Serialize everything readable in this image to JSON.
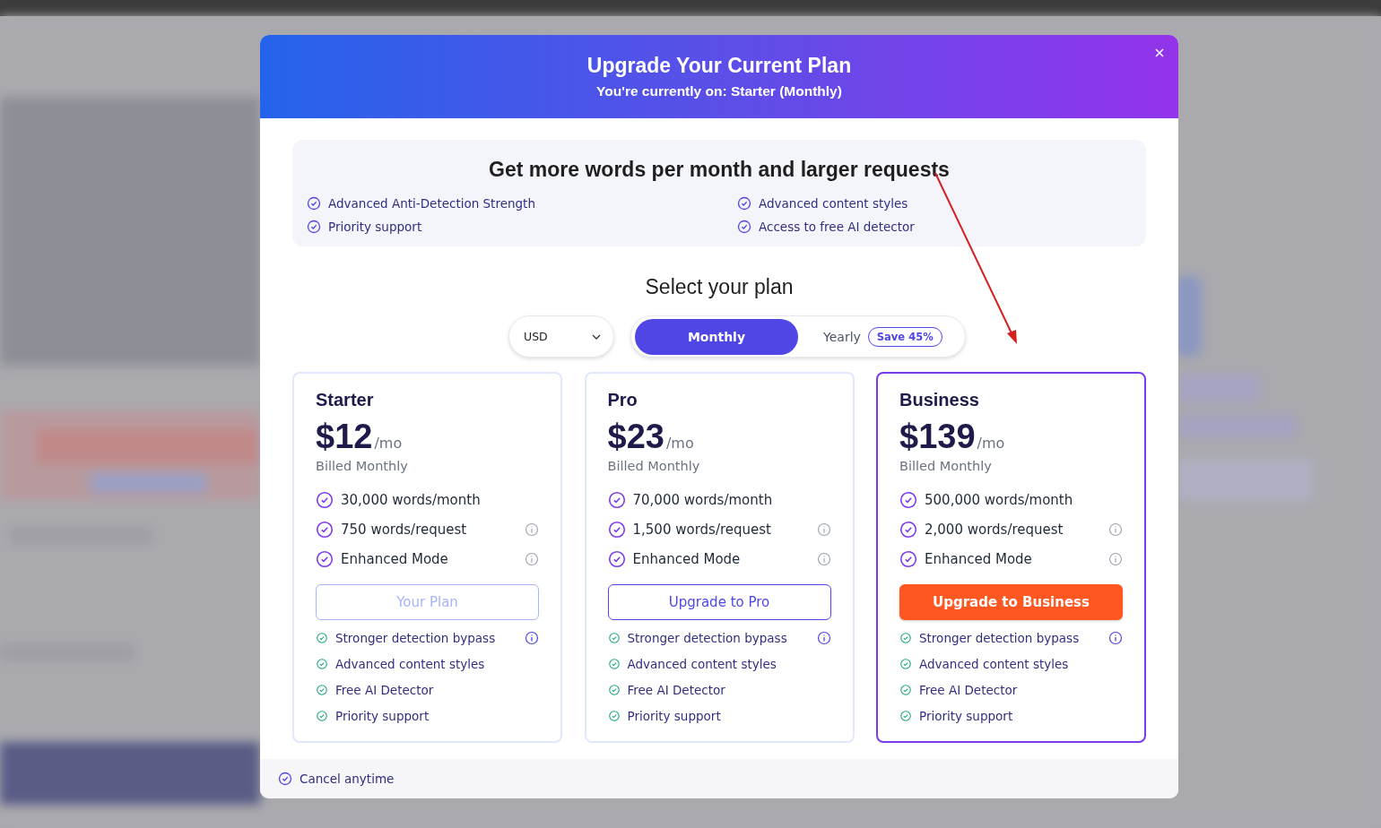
{
  "modal": {
    "title": "Upgrade Your Current Plan",
    "subtitle": "You're currently on: Starter (Monthly)"
  },
  "benefits": {
    "heading": "Get more words per month and larger requests",
    "items": [
      "Advanced Anti-Detection Strength",
      "Advanced content styles",
      "Priority support",
      "Access to free AI detector"
    ]
  },
  "plan_selector": {
    "heading": "Select your plan",
    "currency": "USD",
    "periods": [
      {
        "label": "Monthly",
        "selected": true
      },
      {
        "label": "Yearly",
        "selected": false,
        "badge": "Save 45%"
      }
    ]
  },
  "plans": [
    {
      "name": "Starter",
      "price": "$12",
      "unit": "/mo",
      "billing": "Billed Monthly",
      "selected": false,
      "features": [
        {
          "text": "30,000 words/month",
          "info": false
        },
        {
          "text": "750 words/request",
          "info": true
        },
        {
          "text": "Enhanced Mode",
          "info": true
        }
      ],
      "button": {
        "label": "Your Plan",
        "kind": "current"
      },
      "extras": [
        {
          "text": "Stronger detection bypass",
          "info": true
        },
        {
          "text": "Advanced content styles",
          "info": false
        },
        {
          "text": "Free AI Detector",
          "info": false
        },
        {
          "text": "Priority support",
          "info": false
        }
      ]
    },
    {
      "name": "Pro",
      "price": "$23",
      "unit": "/mo",
      "billing": "Billed Monthly",
      "selected": false,
      "features": [
        {
          "text": "70,000 words/month",
          "info": false
        },
        {
          "text": "1,500 words/request",
          "info": true
        },
        {
          "text": "Enhanced Mode",
          "info": true
        }
      ],
      "button": {
        "label": "Upgrade to Pro",
        "kind": "outline"
      },
      "extras": [
        {
          "text": "Stronger detection bypass",
          "info": true
        },
        {
          "text": "Advanced content styles",
          "info": false
        },
        {
          "text": "Free AI Detector",
          "info": false
        },
        {
          "text": "Priority support",
          "info": false
        }
      ]
    },
    {
      "name": "Business",
      "price": "$139",
      "unit": "/mo",
      "billing": "Billed Monthly",
      "selected": true,
      "features": [
        {
          "text": "500,000 words/month",
          "info": false
        },
        {
          "text": "2,000 words/request",
          "info": true
        },
        {
          "text": "Enhanced Mode",
          "info": true
        }
      ],
      "button": {
        "label": "Upgrade to Business",
        "kind": "primary"
      },
      "extras": [
        {
          "text": "Stronger detection bypass",
          "info": true
        },
        {
          "text": "Advanced content styles",
          "info": false
        },
        {
          "text": "Free AI Detector",
          "info": false
        },
        {
          "text": "Priority support",
          "info": false
        }
      ]
    }
  ],
  "footer": {
    "note": "Cancel anytime"
  }
}
